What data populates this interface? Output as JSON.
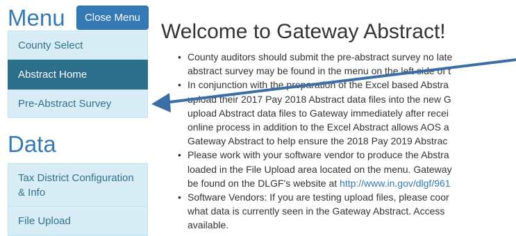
{
  "sidebar": {
    "menu_title": "Menu",
    "close_button": "Close Menu",
    "items": [
      {
        "label": "County Select"
      },
      {
        "label": "Abstract Home"
      },
      {
        "label": "Pre-Abstract Survey"
      }
    ],
    "data_title": "Data",
    "data_items": [
      {
        "label": "Tax District Configuration & Info"
      },
      {
        "label": "File Upload"
      }
    ]
  },
  "main": {
    "title": "Welcome to Gateway Abstract!",
    "bullets": [
      {
        "lines": [
          "County auditors should submit the pre-abstract survey no late",
          "abstract survey may be found in the menu on the left side of t"
        ]
      },
      {
        "lines": [
          "In conjunction with the preparation of the Excel based Abstra",
          "upload their 2017 Pay 2018 Abstract data files into the new G",
          "upload Abstract data files to Gateway immediately after recei",
          "online process in addition to the Excel Abstract allows AOS a",
          "Gateway Abstract to help ensure the 2018 Pay 2019 Abstrac"
        ]
      },
      {
        "lines": [
          "Please work with your software vendor to produce the Abstra",
          "loaded in the File Upload area located on the menu. Gateway"
        ],
        "last_prefix": "be found on the DLGF's website at ",
        "link": "http://www.in.gov/dlgf/961"
      },
      {
        "lines": [
          "Software Vendors: If you are testing upload files, please coor",
          "what data is currently seen in the Gateway Abstract. Access",
          "available."
        ]
      }
    ]
  },
  "colors": {
    "accent": "#337ab7",
    "menu_item_bg": "#d9edf7",
    "menu_item_text": "#31708f",
    "active_item_bg": "#2c6f8a",
    "annotation_arrow": "#3b6ea5"
  }
}
